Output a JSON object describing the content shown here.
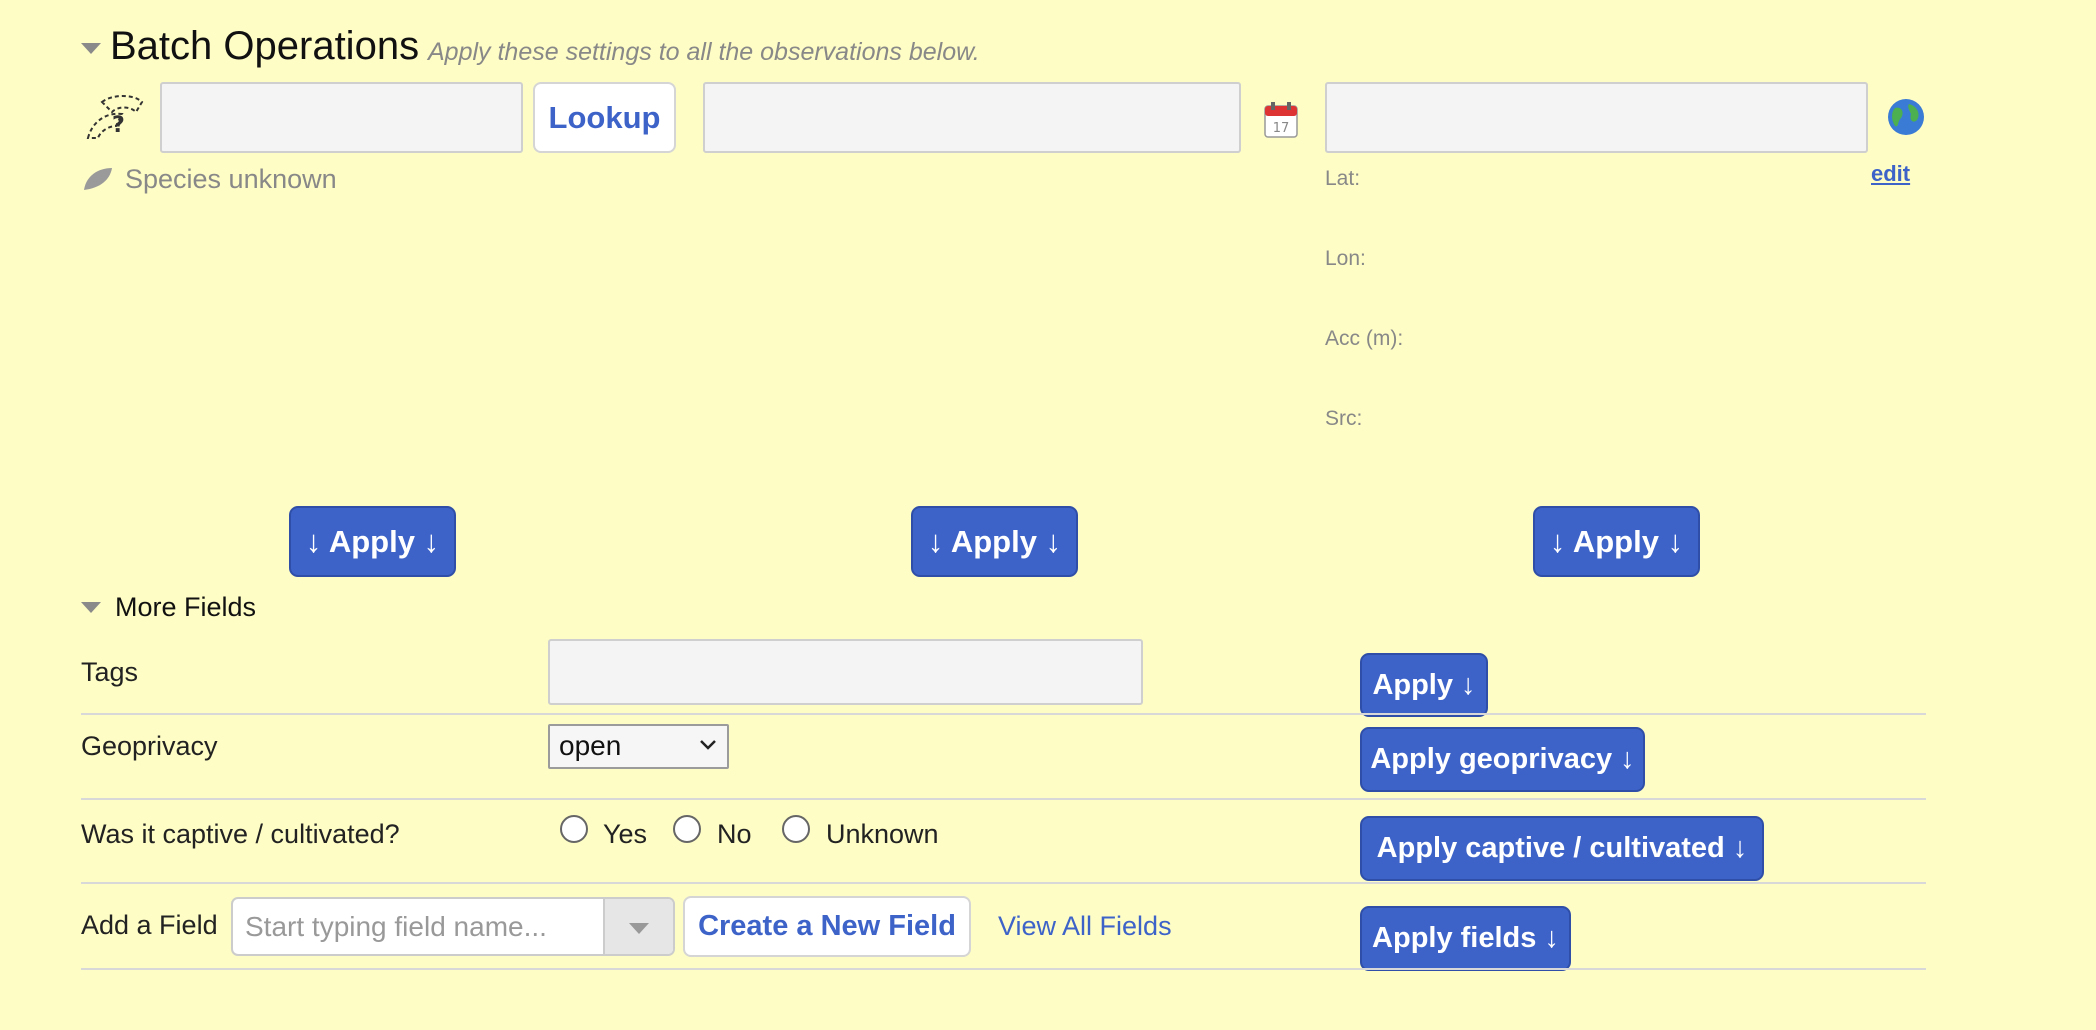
{
  "batch": {
    "title": "Batch Operations",
    "subtitle": "Apply these settings to all the observations below.",
    "lookup_label": "Lookup",
    "species_unknown": "Species unknown",
    "edit_label": "edit",
    "location_meta": {
      "lat": "Lat:",
      "lon": "Lon:",
      "acc": "Acc (m):",
      "src": "Src:"
    },
    "apply_taxon": "↓ Apply ↓",
    "apply_date": "↓ Apply ↓",
    "apply_location": "↓ Apply ↓",
    "icons": {
      "taxon": "unknown-taxon-icon",
      "calendar": "calendar-icon",
      "globe": "globe-icon",
      "leaf": "leaf-icon"
    }
  },
  "more_fields": {
    "title": "More Fields",
    "tags": {
      "label": "Tags",
      "apply": "Apply ↓"
    },
    "geoprivacy": {
      "label": "Geoprivacy",
      "selected": "open",
      "apply": "Apply geoprivacy ↓"
    },
    "captive": {
      "label": "Was it captive / cultivated?",
      "options": [
        "Yes",
        "No",
        "Unknown"
      ],
      "apply": "Apply captive / cultivated ↓"
    },
    "add_field": {
      "label": "Add a Field",
      "placeholder": "Start typing field name...",
      "create": "Create a New Field",
      "view_all": "View All Fields",
      "apply": "Apply fields ↓"
    }
  },
  "colors": {
    "background": "#fefdc5",
    "primary": "#3d63c9"
  }
}
